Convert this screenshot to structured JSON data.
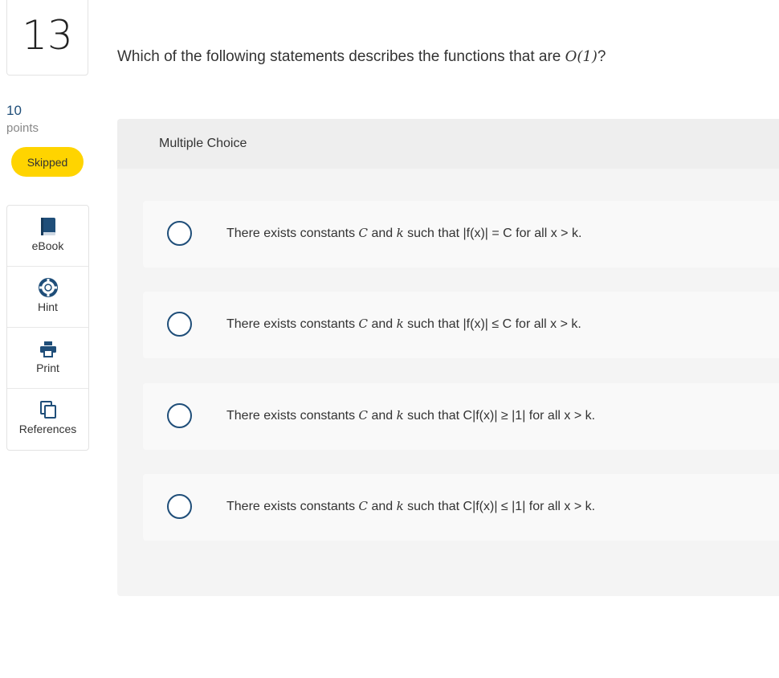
{
  "question_number": "13",
  "points": {
    "value": "10",
    "label": "points"
  },
  "status": "Skipped",
  "tools": [
    {
      "label": "eBook",
      "icon": "book-icon"
    },
    {
      "label": "Hint",
      "icon": "lifebuoy-icon"
    },
    {
      "label": "Print",
      "icon": "printer-icon"
    },
    {
      "label": "References",
      "icon": "copy-pages-icon"
    }
  ],
  "question": {
    "prefix": "Which of the following statements describes the functions that are ",
    "math": "O(1)",
    "suffix": "?"
  },
  "panel_title": "Multiple Choice",
  "options": [
    {
      "pre": "There exists constants ",
      "v1": "C",
      "mid": " and ",
      "v2": "k",
      "rel": " such that |f(x)| = C for all x > k."
    },
    {
      "pre": "There exists constants ",
      "v1": "C",
      "mid": " and ",
      "v2": "k",
      "rel": " such that |f(x)| ≤ C for all x > k."
    },
    {
      "pre": "There exists constants ",
      "v1": "C",
      "mid": " and ",
      "v2": "k",
      "rel": " such that C|f(x)| ≥ |1| for all x > k."
    },
    {
      "pre": "There exists constants ",
      "v1": "C",
      "mid": " and ",
      "v2": "k",
      "rel": " such that C|f(x)| ≤ |1| for all x > k."
    }
  ],
  "colors": {
    "accent": "#1f4e79",
    "badge": "#ffd400"
  }
}
